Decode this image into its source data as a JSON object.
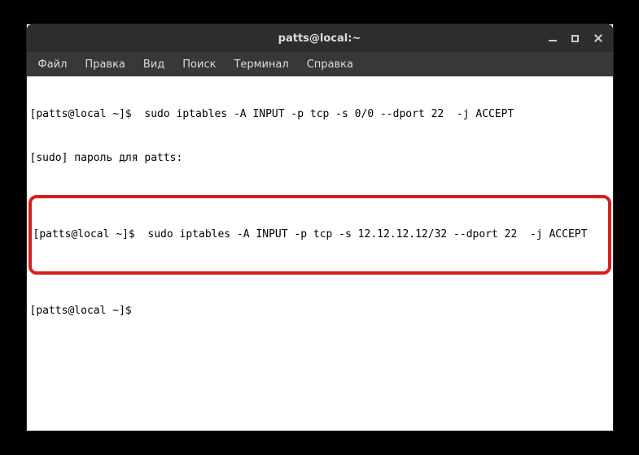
{
  "titlebar": {
    "title": "patts@local:~"
  },
  "menubar": {
    "items": [
      {
        "label": "Файл"
      },
      {
        "label": "Правка"
      },
      {
        "label": "Вид"
      },
      {
        "label": "Поиск"
      },
      {
        "label": "Терминал"
      },
      {
        "label": "Справка"
      }
    ]
  },
  "terminal": {
    "lines": [
      "[patts@local ~]$  sudo iptables -A INPUT -p tcp -s 0/0 --dport 22  -j ACCEPT",
      "[sudo] пароль для patts:"
    ],
    "highlighted": "[patts@local ~]$  sudo iptables -A INPUT -p tcp -s 12.12.12.12/32 --dport 22  -j ACCEPT",
    "after": [
      "[patts@local ~]$"
    ]
  }
}
